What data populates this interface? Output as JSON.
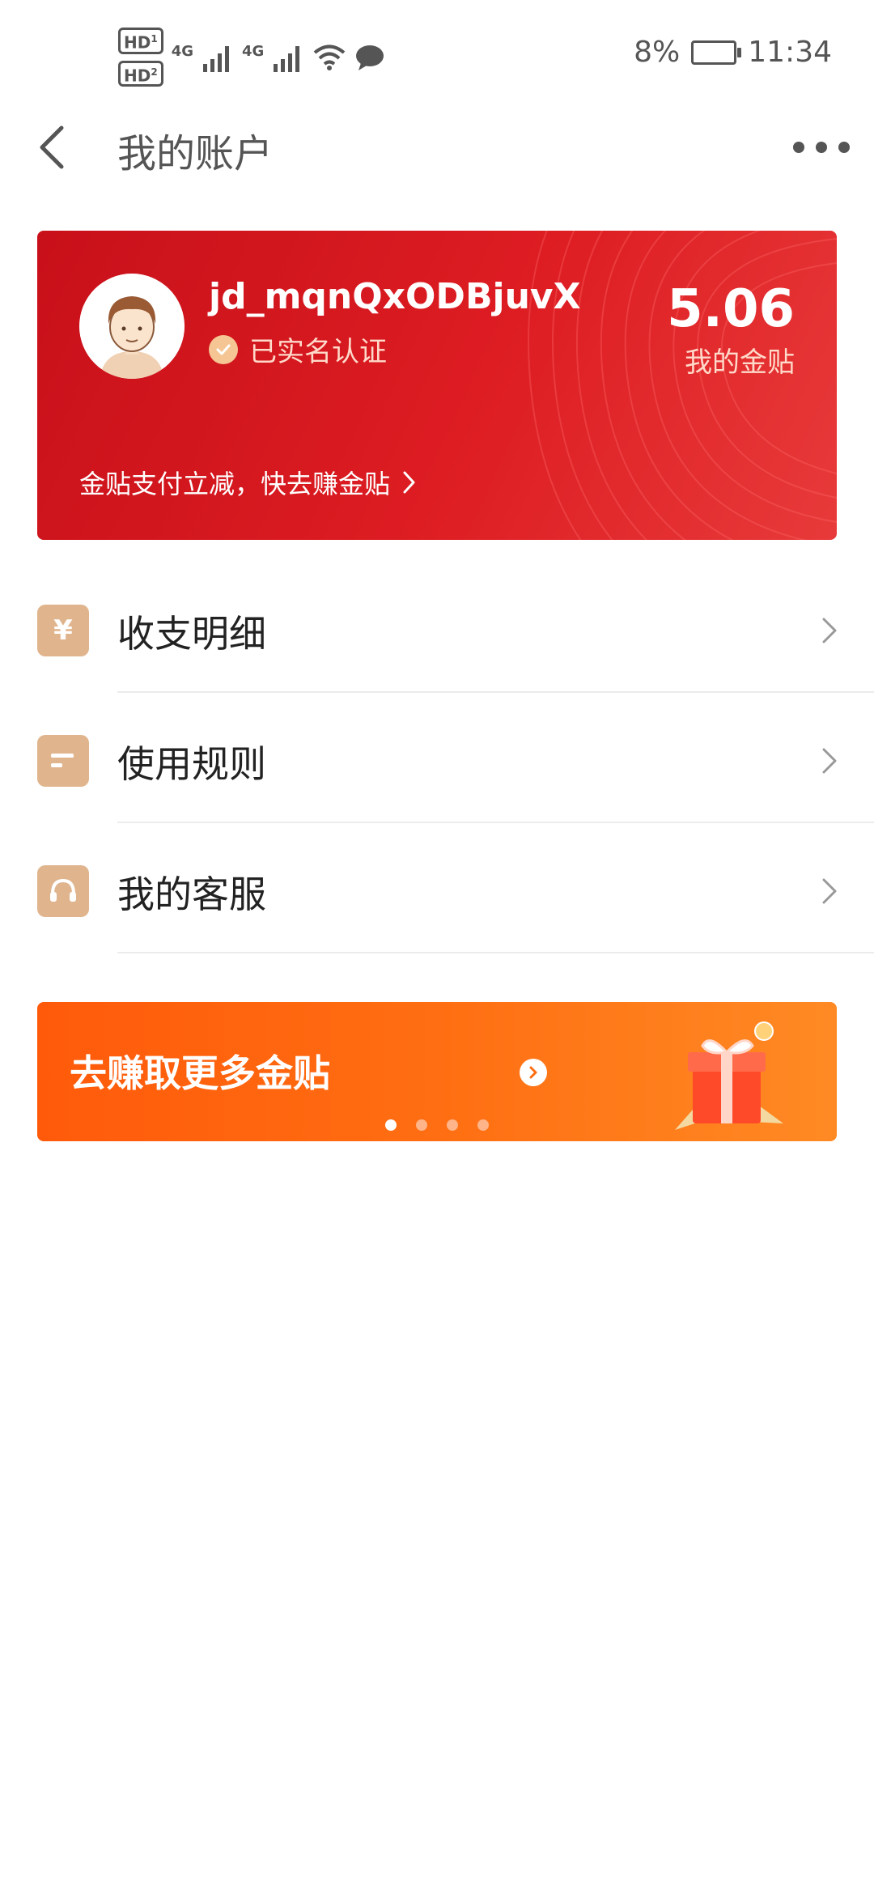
{
  "status_bar": {
    "sim1": "HD",
    "sim1_num": "1",
    "sim2": "HD",
    "sim2_num": "2",
    "network1": "4G",
    "network2": "4G",
    "battery": "8%",
    "time": "11:34"
  },
  "header": {
    "title": "我的账户"
  },
  "account": {
    "username": "jd_mqnQxODBjuvX",
    "verified_text": "已实名认证",
    "amount": "5.06",
    "amount_label": "我的金贴",
    "promo_text": "金贴支付立减，快去赚金贴"
  },
  "menu": {
    "items": [
      {
        "label": "收支明细",
        "icon": "yuan-icon",
        "icon_glyph": "¥"
      },
      {
        "label": "使用规则",
        "icon": "rules-icon"
      },
      {
        "label": "我的客服",
        "icon": "headset-icon"
      }
    ]
  },
  "banner": {
    "text": "去赚取更多金贴",
    "page_count": 4,
    "active_page": 1
  },
  "colors": {
    "card_red": "#dd1d22",
    "icon_tan": "#e0b48d",
    "banner_orange": "#ff6e12"
  }
}
